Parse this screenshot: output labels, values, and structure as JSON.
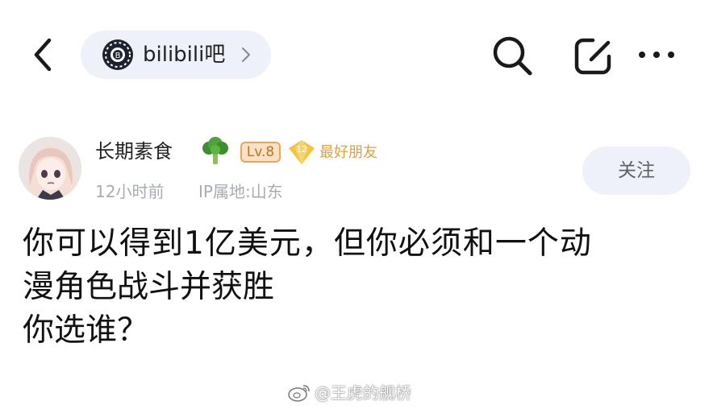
{
  "header": {
    "forum_name": "bilibili吧",
    "icons": {
      "back": "back-arrow-icon",
      "forum_logo": "bilibili-bar-logo-icon",
      "forum_chevron": "chevron-right-icon",
      "search": "search-icon",
      "edit": "edit-icon",
      "more": "more-icon"
    }
  },
  "author": {
    "name": "长期素食",
    "name_emoji": "broccoli-icon",
    "level": "Lv.8",
    "fan_level": "12",
    "fan_label": "最好朋友",
    "time": "12小时前",
    "ip": "IP属地:山东",
    "follow_label": "关注"
  },
  "post": {
    "lines": [
      "你可以得到1亿美元，但你必须和一个动",
      "漫角色战斗并获胜",
      "你选谁？"
    ]
  },
  "watermark": {
    "text": "@王虎的舰桥",
    "logo": "weibo-logo-icon"
  },
  "colors": {
    "pill_bg": "#eef1fa",
    "level_text": "#c8701f",
    "fan_text": "#e0a23a",
    "meta_text": "#a8abb3",
    "body_text": "#111111"
  }
}
